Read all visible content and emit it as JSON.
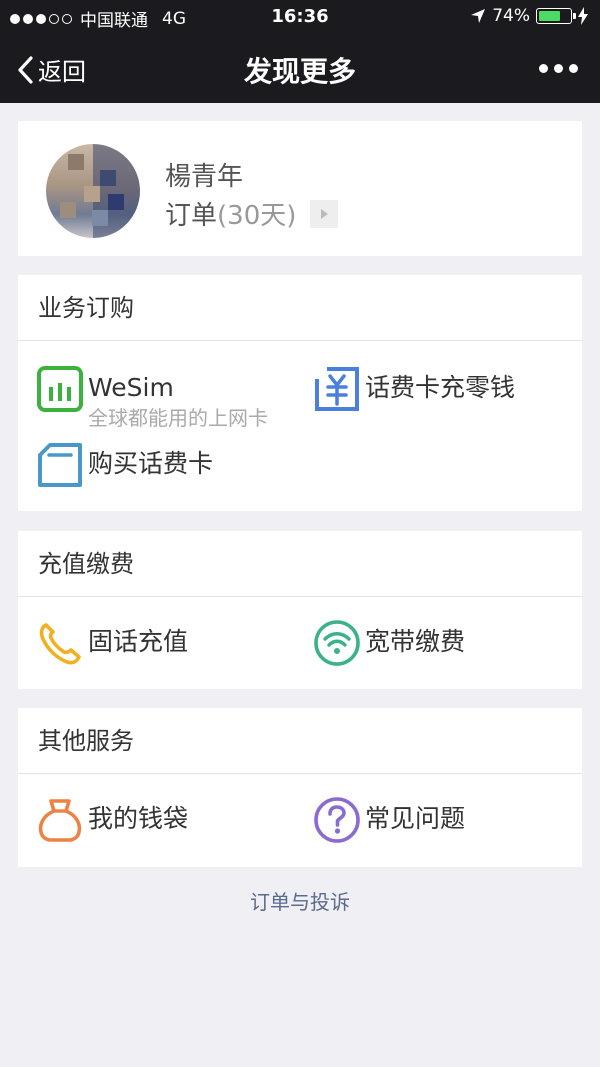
{
  "status": {
    "carrier": "中国联通",
    "network": "4G",
    "time": "16:36",
    "battery_percent": "74%",
    "battery_level": 0.74,
    "signal_bars_filled": 3,
    "signal_bars_total": 5
  },
  "nav": {
    "back_label": "返回",
    "title": "发现更多"
  },
  "profile": {
    "name": "楊青年",
    "order_label": "订单",
    "order_days": "(30天)"
  },
  "sections": [
    {
      "title": "业务订购",
      "items": [
        {
          "label": "WeSim",
          "sub": "全球都能用的上网卡",
          "icon": "wesim-icon",
          "color": "#3bb23e"
        },
        {
          "label": "话费卡充零钱",
          "icon": "yuan-card-icon",
          "color": "#4a80dc"
        },
        {
          "label": "购买话费卡",
          "icon": "card-icon",
          "color": "#4a98c9"
        }
      ]
    },
    {
      "title": "充值缴费",
      "items": [
        {
          "label": "固话充值",
          "icon": "phone-icon",
          "color": "#f2b021"
        },
        {
          "label": "宽带缴费",
          "icon": "wifi-icon",
          "color": "#3bb28a"
        }
      ]
    },
    {
      "title": "其他服务",
      "items": [
        {
          "label": "我的钱袋",
          "icon": "money-bag-icon",
          "color": "#ec8244"
        },
        {
          "label": "常见问题",
          "icon": "question-icon",
          "color": "#8a6bd0"
        }
      ]
    }
  ],
  "footer": {
    "link": "订单与投诉"
  }
}
